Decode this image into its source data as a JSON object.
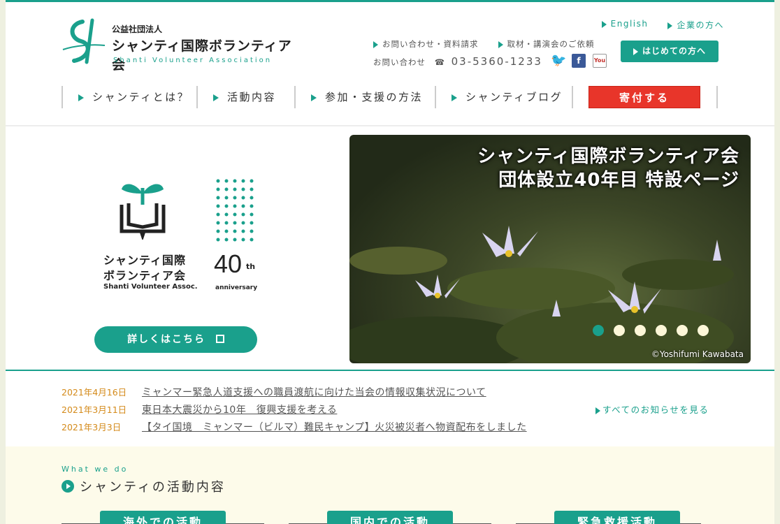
{
  "header": {
    "org_type": "公益社団法人",
    "org_name": "シャンティ国際ボランティア会",
    "org_name_en": "Shanti Volunteer Association",
    "top_links": [
      "English",
      "企業の方へ"
    ],
    "mid_links": [
      "お問い合わせ・資料請求",
      "取材・講演会のご依頼"
    ],
    "phone_label": "お問い合わせ",
    "phone_icon": "☎",
    "phone_number": "03-5360-1233",
    "first_time_button": "はじめての方へ",
    "social": [
      "twitter-icon",
      "facebook-icon",
      "youtube-icon"
    ]
  },
  "nav": {
    "items": [
      "シャンティとは？",
      "活動内容",
      "参加・支援の方法",
      "シャンティブログ"
    ],
    "donate": "寄付する"
  },
  "hero": {
    "logo_line1": "シャンティ国際",
    "logo_line2": "ボランティア会",
    "logo_en": "Shanti Volunteer Assoc.",
    "anniv_num": "40",
    "anniv_th": "th",
    "anniv_word": "anniversary",
    "detail_button": "詳しくはこちら",
    "slide_title_1": "シャンティ国際ボランティア会",
    "slide_title_2": "団体設立40年目 特設ページ",
    "slide_credit": "©Yoshifumi Kawabata",
    "slide_count": 6,
    "active_slide": 1
  },
  "news": {
    "items": [
      {
        "date": "2021年4月16日",
        "title": "ミャンマー緊急人道支援への職員渡航に向けた当会の情報収集状況について"
      },
      {
        "date": "2021年3月11日",
        "title": "東日本大震災から10年　復興支援を考える"
      },
      {
        "date": "2021年3月3日",
        "title": "【タイ国境　ミャンマー（ビルマ）難民キャンプ】火災被災者へ物資配布をしました"
      }
    ],
    "all_link": "すべてのお知らせを見る"
  },
  "activities": {
    "label_en": "What we do",
    "title": "シャンティの活動内容",
    "tabs": [
      "海外での活動",
      "国内での活動",
      "緊急救援活動"
    ]
  },
  "colors": {
    "accent": "#1aa08c",
    "donate": "#e8352a",
    "date": "#d48a1a",
    "background": "#eef0e0"
  }
}
